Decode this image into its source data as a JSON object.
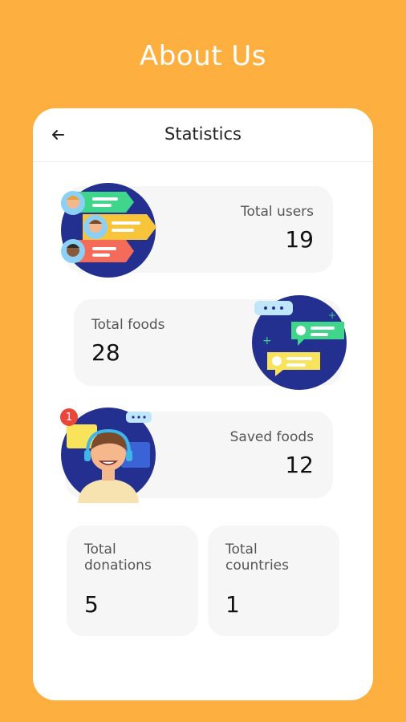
{
  "page": {
    "heading": "About Us"
  },
  "card": {
    "title": "Statistics",
    "back_icon": "arrow-left-icon"
  },
  "stats": {
    "users": {
      "label": "Total users",
      "value": "19"
    },
    "foods": {
      "label": "Total foods",
      "value": "28"
    },
    "saved": {
      "label": "Saved foods",
      "value": "12"
    },
    "donations": {
      "label": "Total\ndonations",
      "value": "5"
    },
    "countries": {
      "label": "Total\ncountries",
      "value": "1"
    }
  },
  "illustrations": {
    "users": "users-chat-illustration",
    "foods": "chat-bubbles-illustration",
    "saved": "support-agent-illustration",
    "saved_badge": "1"
  },
  "colors": {
    "background": "#FDB03F",
    "card": "#FFFFFF",
    "tile": "#F6F6F6",
    "illustration_navy": "#23308F"
  }
}
